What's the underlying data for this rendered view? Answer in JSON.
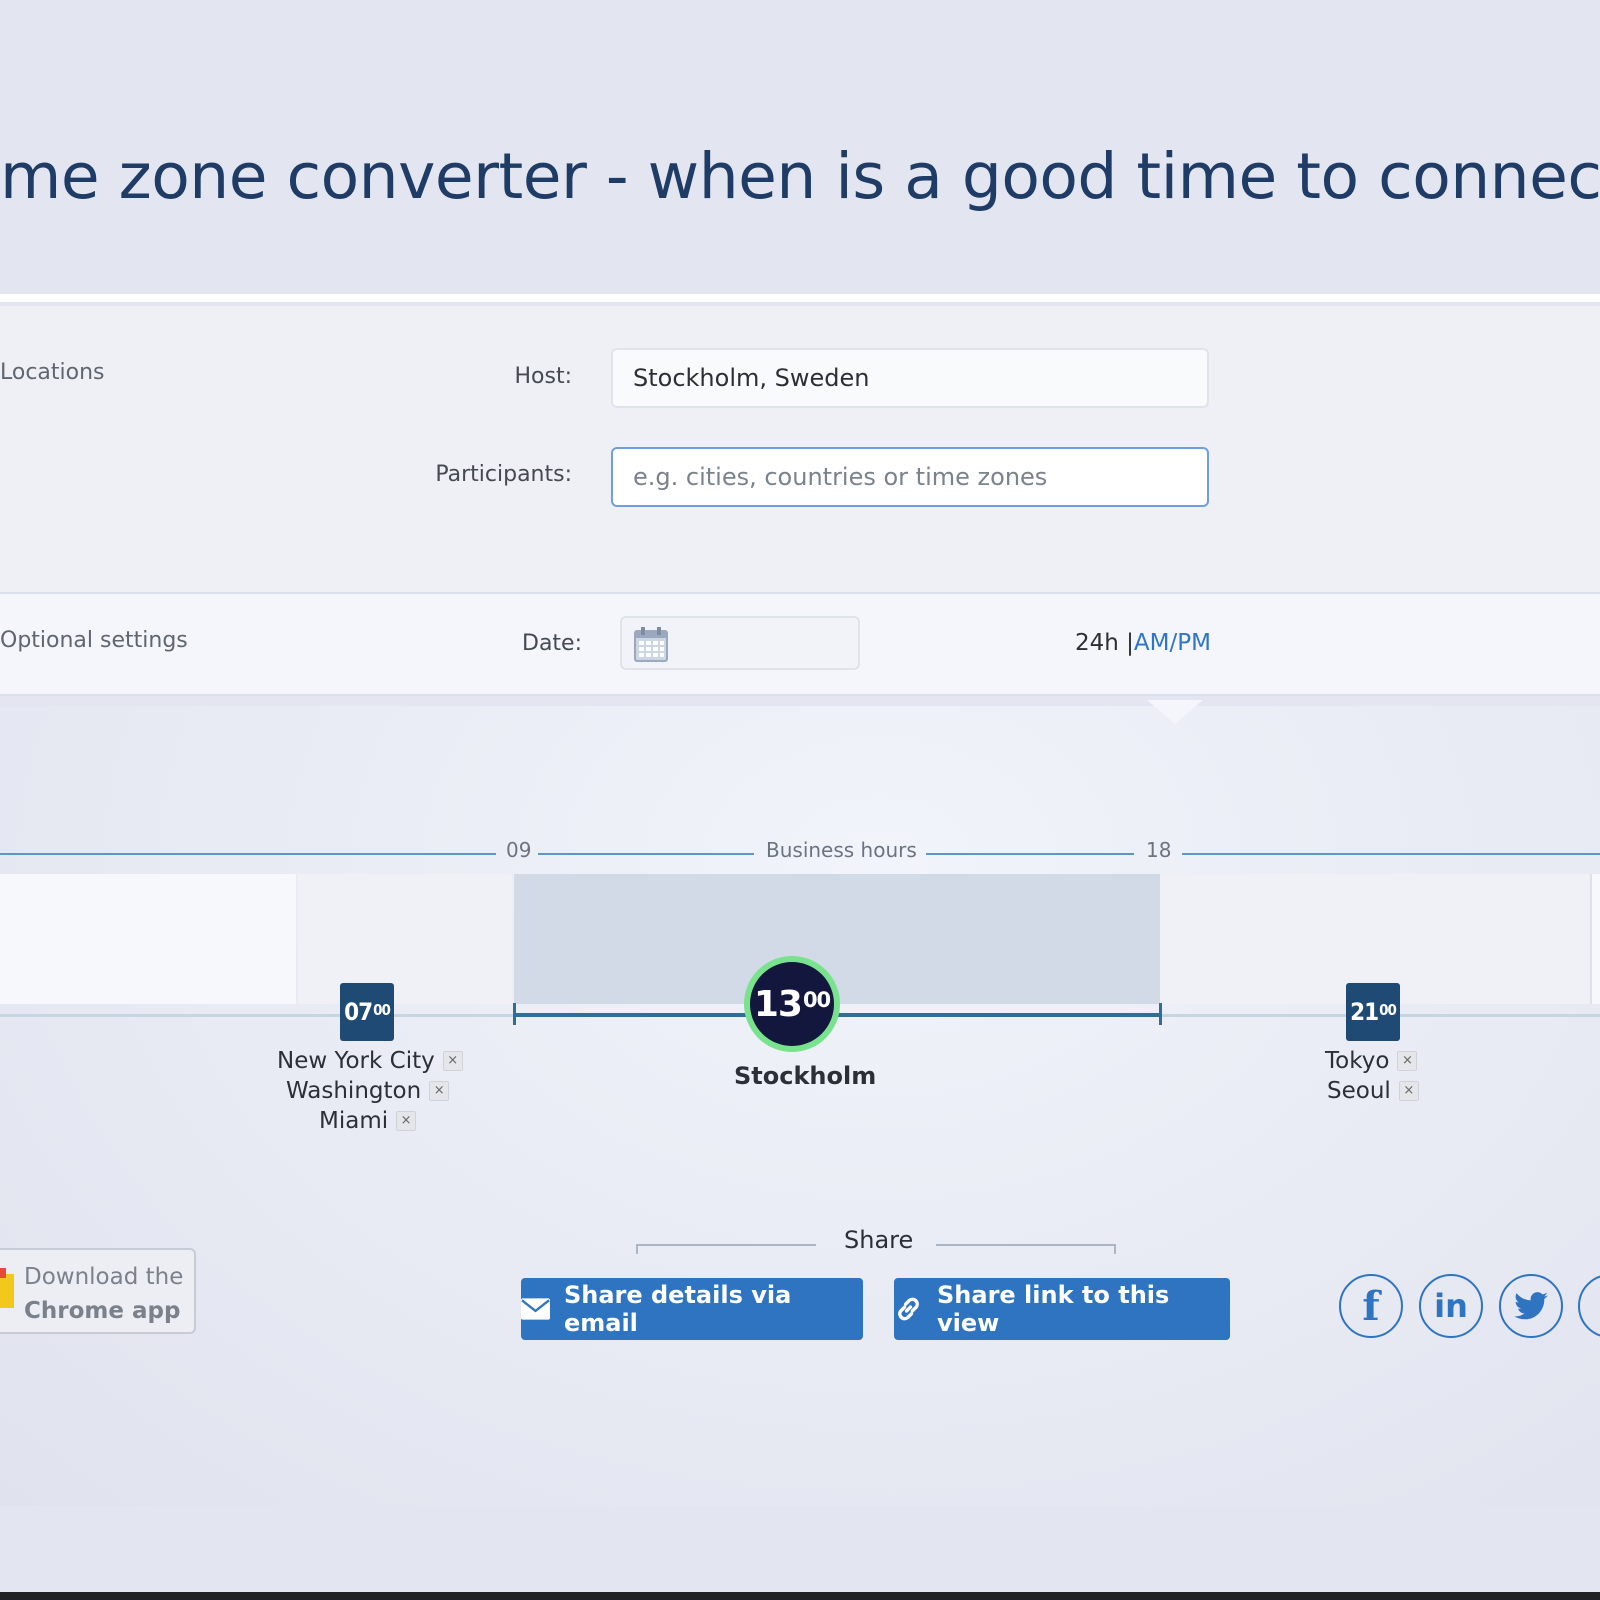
{
  "header": {
    "title": "me zone converter - when is a good time to connect?"
  },
  "locations": {
    "section_label": "Locations",
    "host_label": "Host:",
    "host_value": "Stockholm, Sweden",
    "participants_label": "Participants:",
    "participants_placeholder": "e.g. cities, countries or time zones"
  },
  "optional": {
    "section_label": "Optional settings",
    "date_label": "Date:",
    "format_24h": "24h",
    "format_separator": "|",
    "format_ampm": "AM/PM"
  },
  "timeline": {
    "start_hour_label": "09",
    "business_hours_label": "Business hours",
    "end_hour_label": "18",
    "groups": [
      {
        "hour": "07",
        "minutes": "00",
        "cities": [
          "New York City",
          "Washington",
          "Miami"
        ]
      },
      {
        "hour": "13",
        "minutes": "00",
        "cities": [
          "Stockholm"
        ],
        "host": true
      },
      {
        "hour": "21",
        "minutes": "00",
        "cities": [
          "Tokyo",
          "Seoul"
        ]
      }
    ],
    "remove_symbol": "×",
    "accent_color": "#79e28c",
    "badge_color": "#1e4a74"
  },
  "share": {
    "label": "Share",
    "email_button": "Share details via email",
    "link_button": "Share link to this view"
  },
  "chrome_app": {
    "line1": "Download the",
    "line2": "Chrome app"
  },
  "social": [
    "facebook-icon",
    "linkedin-icon",
    "twitter-icon",
    "more-icon"
  ]
}
